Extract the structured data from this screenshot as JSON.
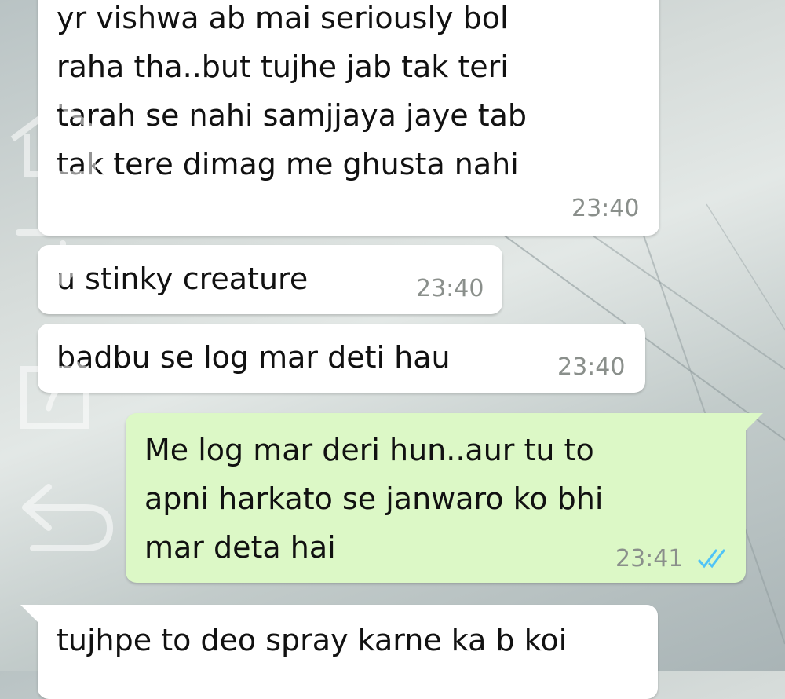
{
  "messages": [
    {
      "id": "m1",
      "direction": "incoming",
      "text": "yr vishwa ab mai seriously bol\nraha tha..but tujhe jab tak teri\ntarah se nahi samjjaya jaye tab\ntak tere dimag me ghusta nahi",
      "time": "23:40"
    },
    {
      "id": "m2",
      "direction": "incoming",
      "text": "u stinky creature",
      "time": "23:40"
    },
    {
      "id": "m3",
      "direction": "incoming",
      "text": "badbu se log mar deti hau",
      "time": "23:40"
    },
    {
      "id": "m4",
      "direction": "outgoing",
      "text": "Me log mar deri hun..aur tu to\napni harkato se janwaro ko bhi\nmar deta hai",
      "time": "23:41",
      "status": "read",
      "status_color": "#4fc3f7"
    },
    {
      "id": "m5",
      "direction": "incoming",
      "text": "tujhpe to deo spray karne ka b koi",
      "time": ""
    }
  ],
  "overlay_icons": [
    "home-icon",
    "download-icon",
    "share-icon",
    "back-icon"
  ],
  "colors": {
    "incoming_bubble": "#ffffff",
    "outgoing_bubble": "#dcf8c6",
    "time": "#8a8f8b"
  }
}
